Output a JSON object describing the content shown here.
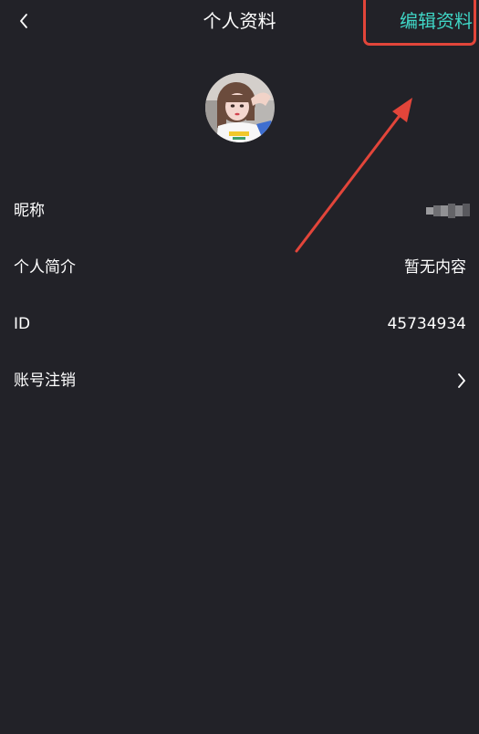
{
  "header": {
    "title": "个人资料",
    "edit_label": "编辑资料",
    "back_icon": "chevron-left-icon"
  },
  "profile": {
    "avatar": "avatar-photo"
  },
  "rows": [
    {
      "label": "昵称",
      "value": ""
    },
    {
      "label": "个人简介",
      "value": "暂无内容"
    },
    {
      "label": "ID",
      "value": "45734934"
    },
    {
      "label": "账号注销",
      "icon": "chevron-right-icon"
    }
  ],
  "colors": {
    "background": "#222228",
    "accent": "#3fd6c6",
    "annotation": "#e2453a"
  }
}
